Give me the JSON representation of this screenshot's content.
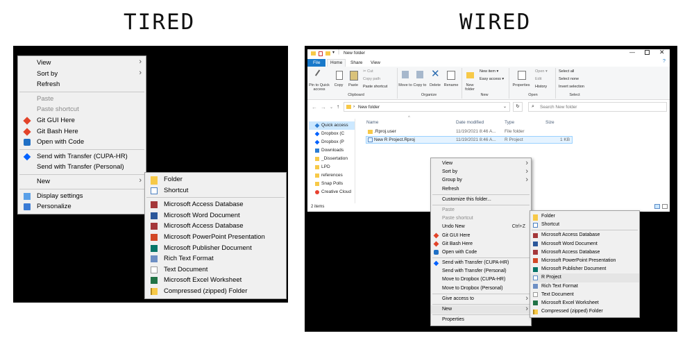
{
  "headings": {
    "left": "TIRED",
    "right": "WIRED"
  },
  "colors": {
    "folder": "#f7c948",
    "git_red": "#e24329",
    "vscode_blue": "#1f6fc5",
    "dropbox_blue": "#0061ff",
    "word": "#2b579a",
    "excel": "#217346",
    "access": "#a4373a",
    "powerpoint": "#d24726",
    "publisher": "#077568",
    "ribbon_file": "#1979ca"
  },
  "tired": {
    "main_menu": [
      {
        "label": "View",
        "arrow": true,
        "icon": null
      },
      {
        "label": "Sort by",
        "arrow": true,
        "icon": null
      },
      {
        "label": "Refresh",
        "icon": null
      },
      {
        "sep": true
      },
      {
        "label": "Paste",
        "disabled": true,
        "icon": null
      },
      {
        "label": "Paste shortcut",
        "disabled": true,
        "icon": null
      },
      {
        "label": "Git GUI Here",
        "icon": "git-icon"
      },
      {
        "label": "Git Bash Here",
        "icon": "git-icon"
      },
      {
        "label": "Open with Code",
        "icon": "vscode-icon"
      },
      {
        "sep": true
      },
      {
        "label": "Send with Transfer (CUPA-HR)",
        "icon": "dropbox-icon"
      },
      {
        "label": "Send with Transfer (Personal)",
        "icon": null
      },
      {
        "sep": true
      },
      {
        "label": "New",
        "arrow": true,
        "icon": null
      },
      {
        "sep": true
      },
      {
        "label": "Display settings",
        "icon": "display-icon"
      },
      {
        "label": "Personalize",
        "icon": "personalize-icon"
      }
    ],
    "new_menu": [
      {
        "label": "Folder",
        "icon": "folder-icon"
      },
      {
        "label": "Shortcut",
        "icon": "shortcut-icon"
      },
      {
        "sep": true
      },
      {
        "label": "Microsoft Access Database",
        "icon": "access-icon"
      },
      {
        "label": "Microsoft Word Document",
        "icon": "word-icon"
      },
      {
        "label": "Microsoft Access Database",
        "icon": "access-icon"
      },
      {
        "label": "Microsoft PowerPoint Presentation",
        "icon": "powerpoint-icon"
      },
      {
        "label": "Microsoft Publisher Document",
        "icon": "publisher-icon"
      },
      {
        "label": "Rich Text Format",
        "icon": "richtext-icon"
      },
      {
        "label": "Text Document",
        "icon": "text-icon"
      },
      {
        "label": "Microsoft Excel Worksheet",
        "icon": "excel-icon"
      },
      {
        "label": "Compressed (zipped) Folder",
        "icon": "zip-icon"
      }
    ]
  },
  "wired": {
    "window_title": "New folder",
    "ribbon_tabs": [
      "File",
      "Home",
      "Share",
      "View"
    ],
    "ribbon": {
      "clipboard": [
        "Pin to Quick access",
        "Copy",
        "Paste"
      ],
      "clipboard_small": [
        "Cut",
        "Copy path",
        "Paste shortcut"
      ],
      "organize": [
        "Move to",
        "Copy to",
        "Delete",
        "Rename"
      ],
      "new": [
        "New folder"
      ],
      "new_small": [
        "New item",
        "Easy access"
      ],
      "open": [
        "Properties"
      ],
      "open_small": [
        "Open",
        "Edit",
        "History"
      ],
      "select_small": [
        "Select all",
        "Select none",
        "Invert selection"
      ],
      "group_labels": [
        "Clipboard",
        "Organize",
        "New",
        "Open",
        "Select"
      ]
    },
    "address": "New folder",
    "search_placeholder": "Search New folder",
    "columns": [
      "Name",
      "Date modified",
      "Type",
      "Size"
    ],
    "files": [
      {
        "name": ".Rproj.user",
        "date": "11/19/2021 8:46 A...",
        "type": "File folder",
        "size": ""
      },
      {
        "name": "New R Project.Rproj",
        "date": "11/19/2021 8:46 A...",
        "type": "R Project",
        "size": "1 KB"
      }
    ],
    "nav": [
      "Quick access",
      "Dropbox (C",
      "Dropbox (P",
      "Downloads",
      "_Dissertation",
      "LPD",
      "references",
      "Snap Polls",
      "Creative Cloud"
    ],
    "status": "2 items",
    "main_menu": [
      {
        "label": "View",
        "arrow": true
      },
      {
        "label": "Sort by",
        "arrow": true
      },
      {
        "label": "Group by",
        "arrow": true
      },
      {
        "label": "Refresh"
      },
      {
        "sep": true
      },
      {
        "label": "Customize this folder..."
      },
      {
        "sep": true
      },
      {
        "label": "Paste",
        "disabled": true
      },
      {
        "label": "Paste shortcut",
        "disabled": true
      },
      {
        "label": "Undo New",
        "shortcut": "Ctrl+Z"
      },
      {
        "label": "Git GUI Here",
        "icon": "git-icon"
      },
      {
        "label": "Git Bash Here",
        "icon": "git-icon"
      },
      {
        "label": "Open with Code",
        "icon": "vscode-icon"
      },
      {
        "sep": true
      },
      {
        "label": "Send with Transfer (CUPA-HR)",
        "icon": "dropbox-icon"
      },
      {
        "label": "Send with Transfer (Personal)"
      },
      {
        "label": "Move to Dropbox (CUPA-HR)"
      },
      {
        "label": "Move to Dropbox (Personal)"
      },
      {
        "sep": true
      },
      {
        "label": "Give access to",
        "arrow": true
      },
      {
        "sep": true
      },
      {
        "label": "New",
        "arrow": true
      },
      {
        "sep": true
      },
      {
        "label": "Properties"
      }
    ],
    "new_menu": [
      {
        "label": "Folder",
        "icon": "folder-icon"
      },
      {
        "label": "Shortcut",
        "icon": "shortcut-icon"
      },
      {
        "sep": true
      },
      {
        "label": "Microsoft Access Database",
        "icon": "access-icon"
      },
      {
        "label": "Microsoft Word Document",
        "icon": "word-icon"
      },
      {
        "label": "Microsoft Access Database",
        "icon": "access-icon"
      },
      {
        "label": "Microsoft PowerPoint Presentation",
        "icon": "powerpoint-icon"
      },
      {
        "label": "Microsoft Publisher Document",
        "icon": "publisher-icon"
      },
      {
        "label": "R Project",
        "icon": "rproject-icon"
      },
      {
        "label": "Rich Text Format",
        "icon": "richtext-icon"
      },
      {
        "label": "Text Document",
        "icon": "text-icon"
      },
      {
        "label": "Microsoft Excel Worksheet",
        "icon": "excel-icon"
      },
      {
        "label": "Compressed (zipped) Folder",
        "icon": "zip-icon"
      }
    ]
  }
}
